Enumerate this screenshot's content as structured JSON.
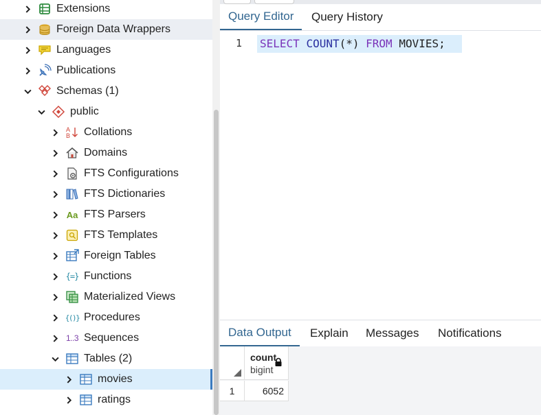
{
  "tree": {
    "items": [
      {
        "label": "Extensions",
        "icon": "extensions-icon"
      },
      {
        "label": "Foreign Data Wrappers",
        "icon": "foreign-data-wrappers-icon"
      },
      {
        "label": "Languages",
        "icon": "languages-icon"
      },
      {
        "label": "Publications",
        "icon": "publications-icon"
      },
      {
        "label": "Schemas (1)",
        "icon": "schemas-icon"
      },
      {
        "label": "public",
        "icon": "schema-public-icon"
      },
      {
        "label": "Collations",
        "icon": "collations-icon"
      },
      {
        "label": "Domains",
        "icon": "domains-icon"
      },
      {
        "label": "FTS Configurations",
        "icon": "fts-configurations-icon"
      },
      {
        "label": "FTS Dictionaries",
        "icon": "fts-dictionaries-icon"
      },
      {
        "label": "FTS Parsers",
        "icon": "fts-parsers-icon"
      },
      {
        "label": "FTS Templates",
        "icon": "fts-templates-icon"
      },
      {
        "label": "Foreign Tables",
        "icon": "foreign-tables-icon"
      },
      {
        "label": "Functions",
        "icon": "functions-icon"
      },
      {
        "label": "Materialized Views",
        "icon": "materialized-views-icon"
      },
      {
        "label": "Procedures",
        "icon": "procedures-icon"
      },
      {
        "label": "Sequences",
        "icon": "sequences-icon"
      },
      {
        "label": "Tables (2)",
        "icon": "tables-icon"
      },
      {
        "label": "movies",
        "icon": "table-icon"
      },
      {
        "label": "ratings",
        "icon": "table-icon"
      }
    ],
    "fts_parsers_glyph": "Aa",
    "sequences_glyph": "1..3",
    "functions_glyph": "{=}",
    "procedures_glyph": "{()}"
  },
  "editor": {
    "tabs": {
      "query_editor": "Query Editor",
      "query_history": "Query History"
    },
    "line_number": "1",
    "code": {
      "select": "SELECT",
      "count": "COUNT",
      "args": "(*)",
      "from": "FROM",
      "table": "MOVIES",
      "semicolon": ";"
    }
  },
  "results": {
    "tabs": {
      "data_output": "Data Output",
      "explain": "Explain",
      "messages": "Messages",
      "notifications": "Notifications"
    },
    "column": {
      "name": "count",
      "type": "bigint"
    },
    "rows": [
      {
        "num": "1",
        "value": "6052"
      }
    ]
  },
  "colors": {
    "accent": "#326690",
    "keyword": "#7a33b9",
    "function": "#2a2f9f",
    "selection": "#dbeefc"
  }
}
